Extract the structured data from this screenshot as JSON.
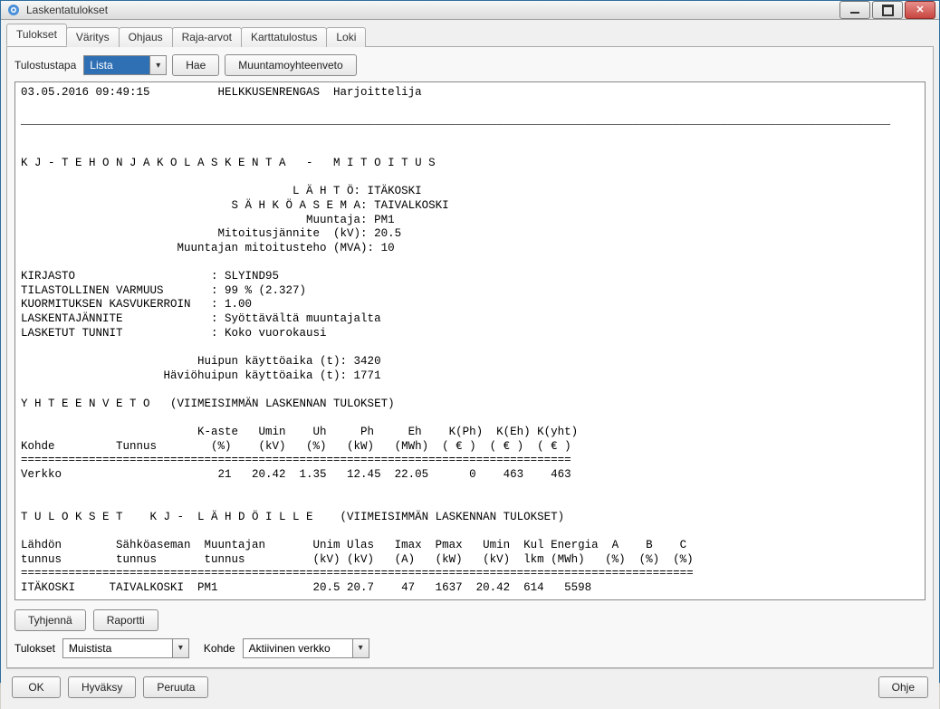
{
  "window": {
    "title": "Laskentatulokset"
  },
  "tabs": [
    "Tulokset",
    "Väritys",
    "Ohjaus",
    "Raja-arvot",
    "Karttatulostus",
    "Loki"
  ],
  "toolbar": {
    "tulostustapa_label": "Tulostustapa",
    "tulostustapa_value": "Lista",
    "hae_label": "Hae",
    "muuntamo_btn": "Muuntamoyhteenveto"
  },
  "report_text": "03.05.2016 09:49:15          HELKKUSENRENGAS  Harjoittelija\n\n________________________________________________________________________________________________________________________________\n\n\nK J - T E H O N J A K O L A S K E N T A   -   M I T O I T U S\n\n                                        L Ä H T Ö: ITÄKOSKI\n                               S Ä H K Ö A S E M A: TAIVALKOSKI\n                                          Muuntaja: PM1\n                             Mitoitusjännite  (kV): 20.5\n                       Muuntajan mitoitusteho (MVA): 10\n\nKIRJASTO                    : SLYIND95\nTILASTOLLINEN VARMUUS       : 99 % (2.327)\nKUORMITUKSEN KASVUKERROIN   : 1.00\nLASKENTAJÄNNITE             : Syöttävältä muuntajalta\nLASKETUT TUNNIT             : Koko vuorokausi\n\n                          Huipun käyttöaika (t): 3420\n                     Häviöhuipun käyttöaika (t): 1771\n\nY H T E E N V E T O   (VIIMEISIMMÄN LASKENNAN TULOKSET)\n\n                          K-aste   Umin    Uh     Ph     Eh    K(Ph)  K(Eh) K(yht)\nKohde         Tunnus        (%)    (kV)   (%)   (kW)   (MWh)  ( € )  ( € )  ( € )\n=================================================================================\nVerkko                       21   20.42  1.35   12.45  22.05      0    463    463\n\n\nT U L O K S E T    K J -  L Ä H D Ö I L L E    (VIIMEISIMMÄN LASKENNAN TULOKSET)\n\nLähdön        Sähköaseman  Muuntajan       Unim Ulas   Imax  Pmax   Umin  Kul Energia  A    B    C\ntunnus        tunnus       tunnus          (kV) (kV)   (A)   (kW)   (kV)  lkm (MWh)   (%)  (%)  (%)\n===================================================================================================\nITÄKOSKI     TAIVALKOSKI  PM1              20.5 20.7    47   1637  20.42  614   5598\n",
  "actions": {
    "tyhjenna": "Tyhjennä",
    "raportti": "Raportti"
  },
  "results_row": {
    "tulokset_label": "Tulokset",
    "tulokset_value": "Muistista",
    "kohde_label": "Kohde",
    "kohde_value": "Aktiivinen verkko"
  },
  "footer": {
    "ok": "OK",
    "hyvaksy": "Hyväksy",
    "peruuta": "Peruuta",
    "ohje": "Ohje"
  }
}
